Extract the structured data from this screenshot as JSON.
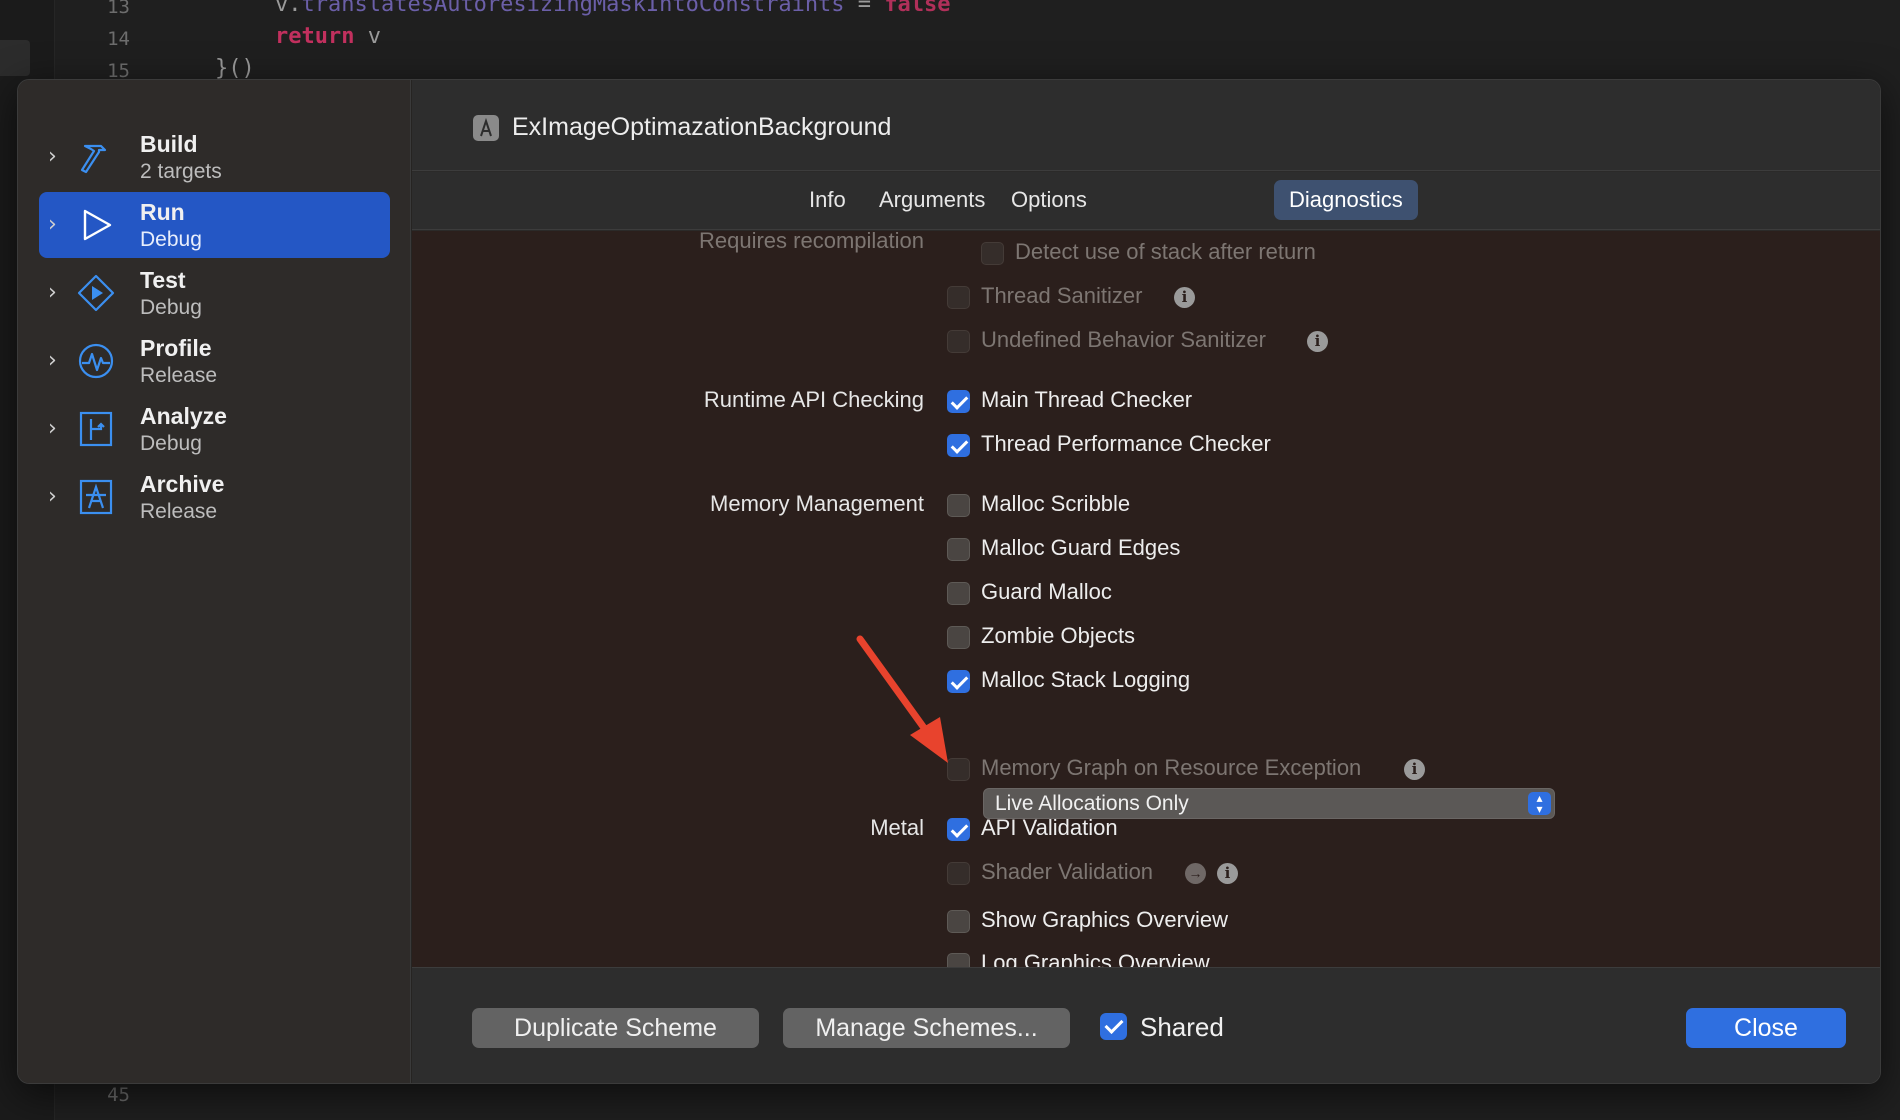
{
  "editor": {
    "lines": [
      {
        "num": "13",
        "code_a": "v.",
        "code_b": "translatesAutoresizingMaskIntoConstraints",
        "code_c": " = ",
        "code_d": "false"
      },
      {
        "num": "14",
        "code_a": "return",
        "code_b": " v"
      },
      {
        "num": "15",
        "code_a": "}()"
      },
      {
        "num": "45",
        "code_a": ""
      }
    ]
  },
  "sidebar": {
    "items": [
      {
        "name": "Build",
        "sub": "2 targets",
        "icon": "hammer-icon"
      },
      {
        "name": "Run",
        "sub": "Debug",
        "icon": "play-icon"
      },
      {
        "name": "Test",
        "sub": "Debug",
        "icon": "diamond-play-icon"
      },
      {
        "name": "Profile",
        "sub": "Release",
        "icon": "waveform-icon"
      },
      {
        "name": "Analyze",
        "sub": "Debug",
        "icon": "branch-icon"
      },
      {
        "name": "Archive",
        "sub": "Release",
        "icon": "archive-app-icon"
      }
    ],
    "selected": "Run"
  },
  "header": {
    "title": "ExImageOptimazationBackground"
  },
  "tabs": [
    "Info",
    "Arguments",
    "Options",
    "Diagnostics"
  ],
  "active_tab": "Diagnostics",
  "diagnostics": {
    "requires_label": "Requires recompilation",
    "detect_stack": "Detect use of stack after return",
    "thread_sanitizer": "Thread Sanitizer",
    "ub_sanitizer": "Undefined Behavior Sanitizer",
    "runtime_api": {
      "label": "Runtime API Checking",
      "main_thread": "Main Thread Checker",
      "thread_perf": "Thread Performance Checker"
    },
    "memory": {
      "label": "Memory Management",
      "malloc_scribble": "Malloc Scribble",
      "malloc_guard_edges": "Malloc Guard Edges",
      "guard_malloc": "Guard Malloc",
      "zombie_objects": "Zombie Objects",
      "malloc_stack_logging": "Malloc Stack Logging",
      "stack_logging_mode": "Live Allocations Only",
      "memory_graph": "Memory Graph on Resource Exception"
    },
    "metal": {
      "label": "Metal",
      "api_validation": "API Validation",
      "shader_validation": "Shader Validation",
      "graphics_overview": "Show Graphics Overview",
      "log_graphics_overview": "Log Graphics Overview"
    }
  },
  "footer": {
    "duplicate": "Duplicate Scheme",
    "manage": "Manage Schemes...",
    "shared": "Shared",
    "close": "Close"
  },
  "colors": {
    "accent": "#2f6fe0",
    "selection": "#2457c5",
    "annotation_arrow": "#e8432d"
  }
}
